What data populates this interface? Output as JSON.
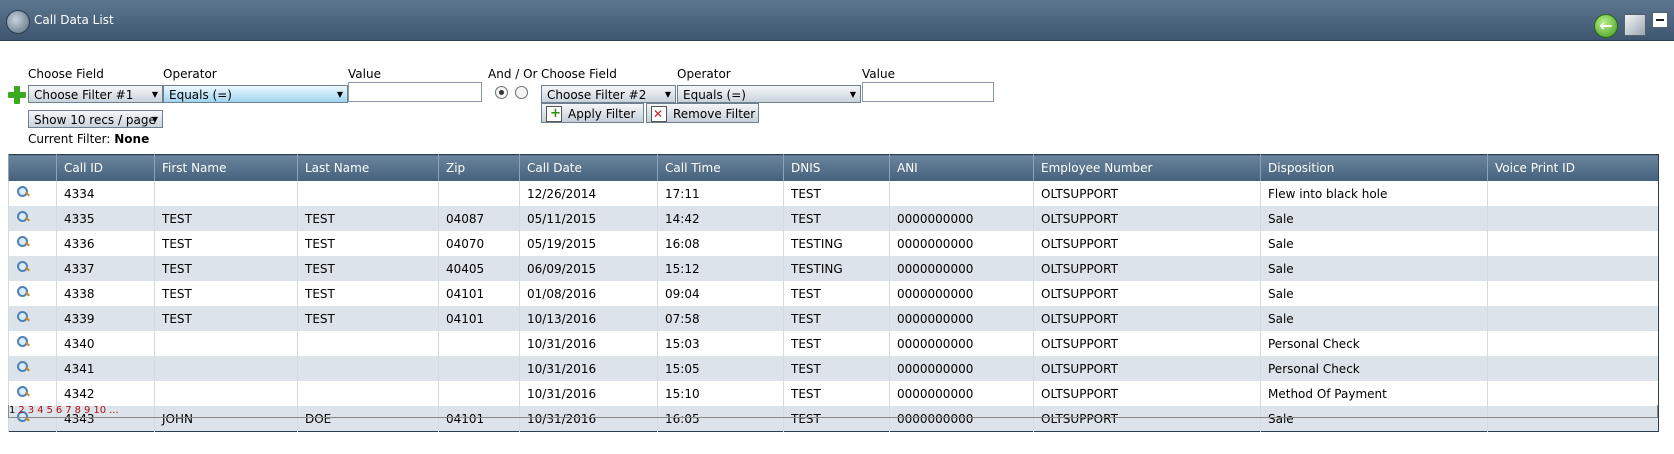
{
  "window": {
    "title": "Call Data List"
  },
  "filter": {
    "choose_field_label_1": "Choose Field",
    "operator_label_1": "Operator",
    "value_label_1": "Value",
    "and_or_label": "And / Or",
    "choose_field_label_2": "Choose Field",
    "operator_label_2": "Operator",
    "value_label_2": "Value",
    "filter1_select": "Choose Filter #1",
    "operator1_select": "Equals (=)",
    "filter2_select": "Choose Filter #2",
    "operator2_select": "Equals (=)",
    "records_per_page": "Show 10 recs / page",
    "apply_button": "Apply Filter",
    "remove_button": "Remove Filter",
    "current_filter_label": "Current Filter:",
    "current_filter_value": "None"
  },
  "table": {
    "columns": [
      "Call ID",
      "First Name",
      "Last Name",
      "Zip",
      "Call Date",
      "Call Time",
      "DNIS",
      "ANI",
      "Employee Number",
      "Disposition",
      "Voice Print ID"
    ],
    "rows": [
      [
        "4334",
        "",
        "",
        "",
        "12/26/2014",
        "17:11",
        "TEST",
        "",
        "OLTSUPPORT",
        "Flew into black hole",
        ""
      ],
      [
        "4335",
        "TEST",
        "TEST",
        "04087",
        "05/11/2015",
        "14:42",
        "TEST",
        "0000000000",
        "OLTSUPPORT",
        "Sale",
        ""
      ],
      [
        "4336",
        "TEST",
        "TEST",
        "04070",
        "05/19/2015",
        "16:08",
        "TESTING",
        "0000000000",
        "OLTSUPPORT",
        "Sale",
        ""
      ],
      [
        "4337",
        "TEST",
        "TEST",
        "40405",
        "06/09/2015",
        "15:12",
        "TESTING",
        "0000000000",
        "OLTSUPPORT",
        "Sale",
        ""
      ],
      [
        "4338",
        "TEST",
        "TEST",
        "04101",
        "01/08/2016",
        "09:04",
        "TEST",
        "0000000000",
        "OLTSUPPORT",
        "Sale",
        ""
      ],
      [
        "4339",
        "TEST",
        "TEST",
        "04101",
        "10/13/2016",
        "07:58",
        "TEST",
        "0000000000",
        "OLTSUPPORT",
        "Sale",
        ""
      ],
      [
        "4340",
        "",
        "",
        "",
        "10/31/2016",
        "15:03",
        "TEST",
        "0000000000",
        "OLTSUPPORT",
        "Personal Check",
        ""
      ],
      [
        "4341",
        "",
        "",
        "",
        "10/31/2016",
        "15:05",
        "TEST",
        "0000000000",
        "OLTSUPPORT",
        "Personal Check",
        ""
      ],
      [
        "4342",
        "",
        "",
        "",
        "10/31/2016",
        "15:10",
        "TEST",
        "0000000000",
        "OLTSUPPORT",
        "Method Of Payment",
        ""
      ],
      [
        "4343",
        "JOHN",
        "DOE",
        "04101",
        "10/31/2016",
        "16:05",
        "TEST",
        "0000000000",
        "OLTSUPPORT",
        "Sale",
        ""
      ]
    ]
  },
  "pager": {
    "pages": [
      "1",
      "2",
      "3",
      "4",
      "5",
      "6",
      "7",
      "8",
      "9",
      "10",
      "..."
    ],
    "current": "1"
  }
}
